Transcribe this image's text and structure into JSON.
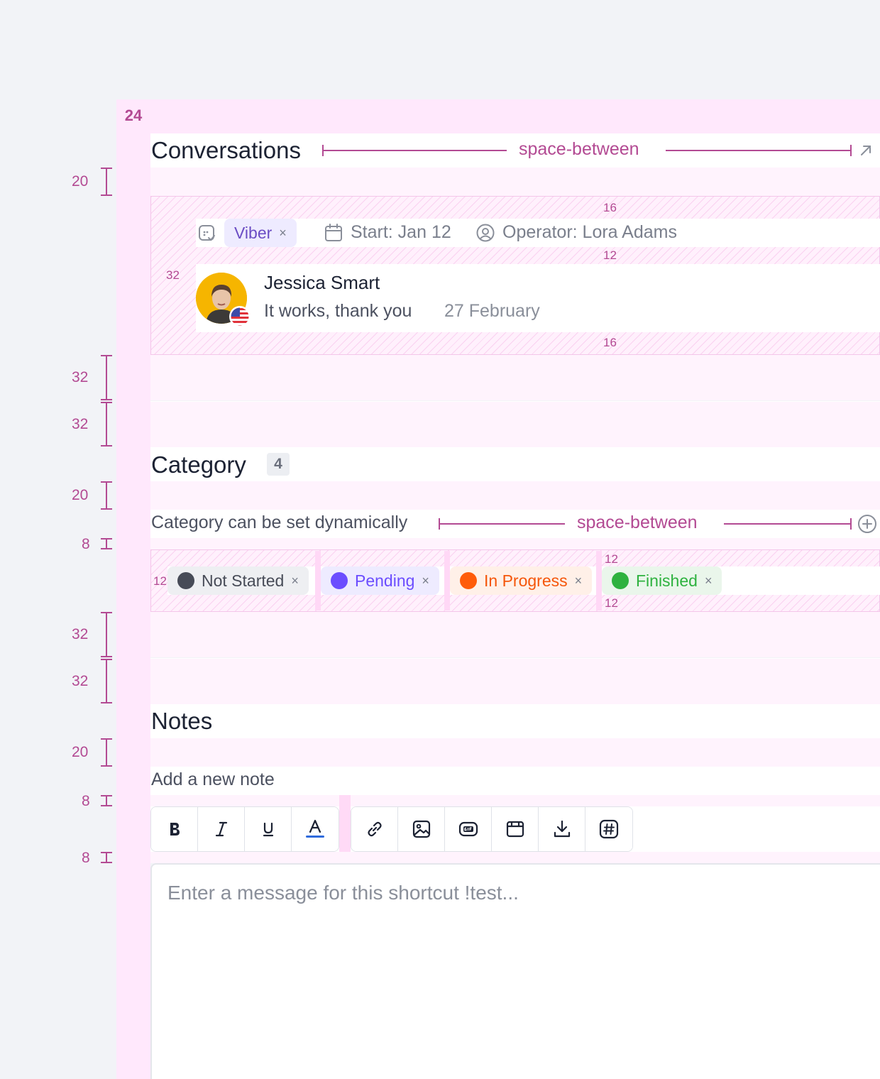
{
  "spacing": {
    "side": "24",
    "s20": "20",
    "s32": "32",
    "s8": "8",
    "s16": "16",
    "s12": "12",
    "space_between": "space-between"
  },
  "conversations": {
    "title": "Conversations",
    "channel": {
      "label": "Viber",
      "remove": "×"
    },
    "start": "Start: Jan 12",
    "operator": "Operator: Lora Adams",
    "contact": {
      "name": "Jessica Smart",
      "message": "It works, thank you",
      "date": "27 February"
    },
    "icons": {
      "channel": "viber-icon",
      "calendar": "calendar-icon",
      "operator": "user-circle-icon",
      "open": "arrow-up-right-icon"
    }
  },
  "category": {
    "title": "Category",
    "count": "4",
    "hint": "Category can be set dynamically",
    "chips": [
      {
        "label": "Not Started",
        "remove": "×",
        "color": "#474b57",
        "bg": "#eeeff2",
        "text": "#474b57"
      },
      {
        "label": "Pending",
        "remove": "×",
        "color": "#6b4dff",
        "bg": "#eeebff",
        "text": "#6b4dff"
      },
      {
        "label": "In Progress",
        "remove": "×",
        "color": "#ff5c0a",
        "bg": "#fff0e8",
        "text": "#f5560a"
      },
      {
        "label": "Finished",
        "remove": "×",
        "color": "#2eb23f",
        "bg": "#eaf6eb",
        "text": "#2eb23f"
      }
    ]
  },
  "notes": {
    "title": "Notes",
    "label": "Add a new note",
    "placeholder": "Enter a message for this shortcut !test...",
    "toolbar_format": [
      "bold-icon",
      "italic-icon",
      "underline-icon",
      "text-color-icon"
    ],
    "toolbar_insert": [
      "link-icon",
      "image-icon",
      "gif-icon",
      "calendar-window-icon",
      "download-icon",
      "hashtag-icon"
    ]
  },
  "colors": {
    "accent": "#b34a93",
    "heading": "#1c2233",
    "muted": "#7a7f8c"
  }
}
